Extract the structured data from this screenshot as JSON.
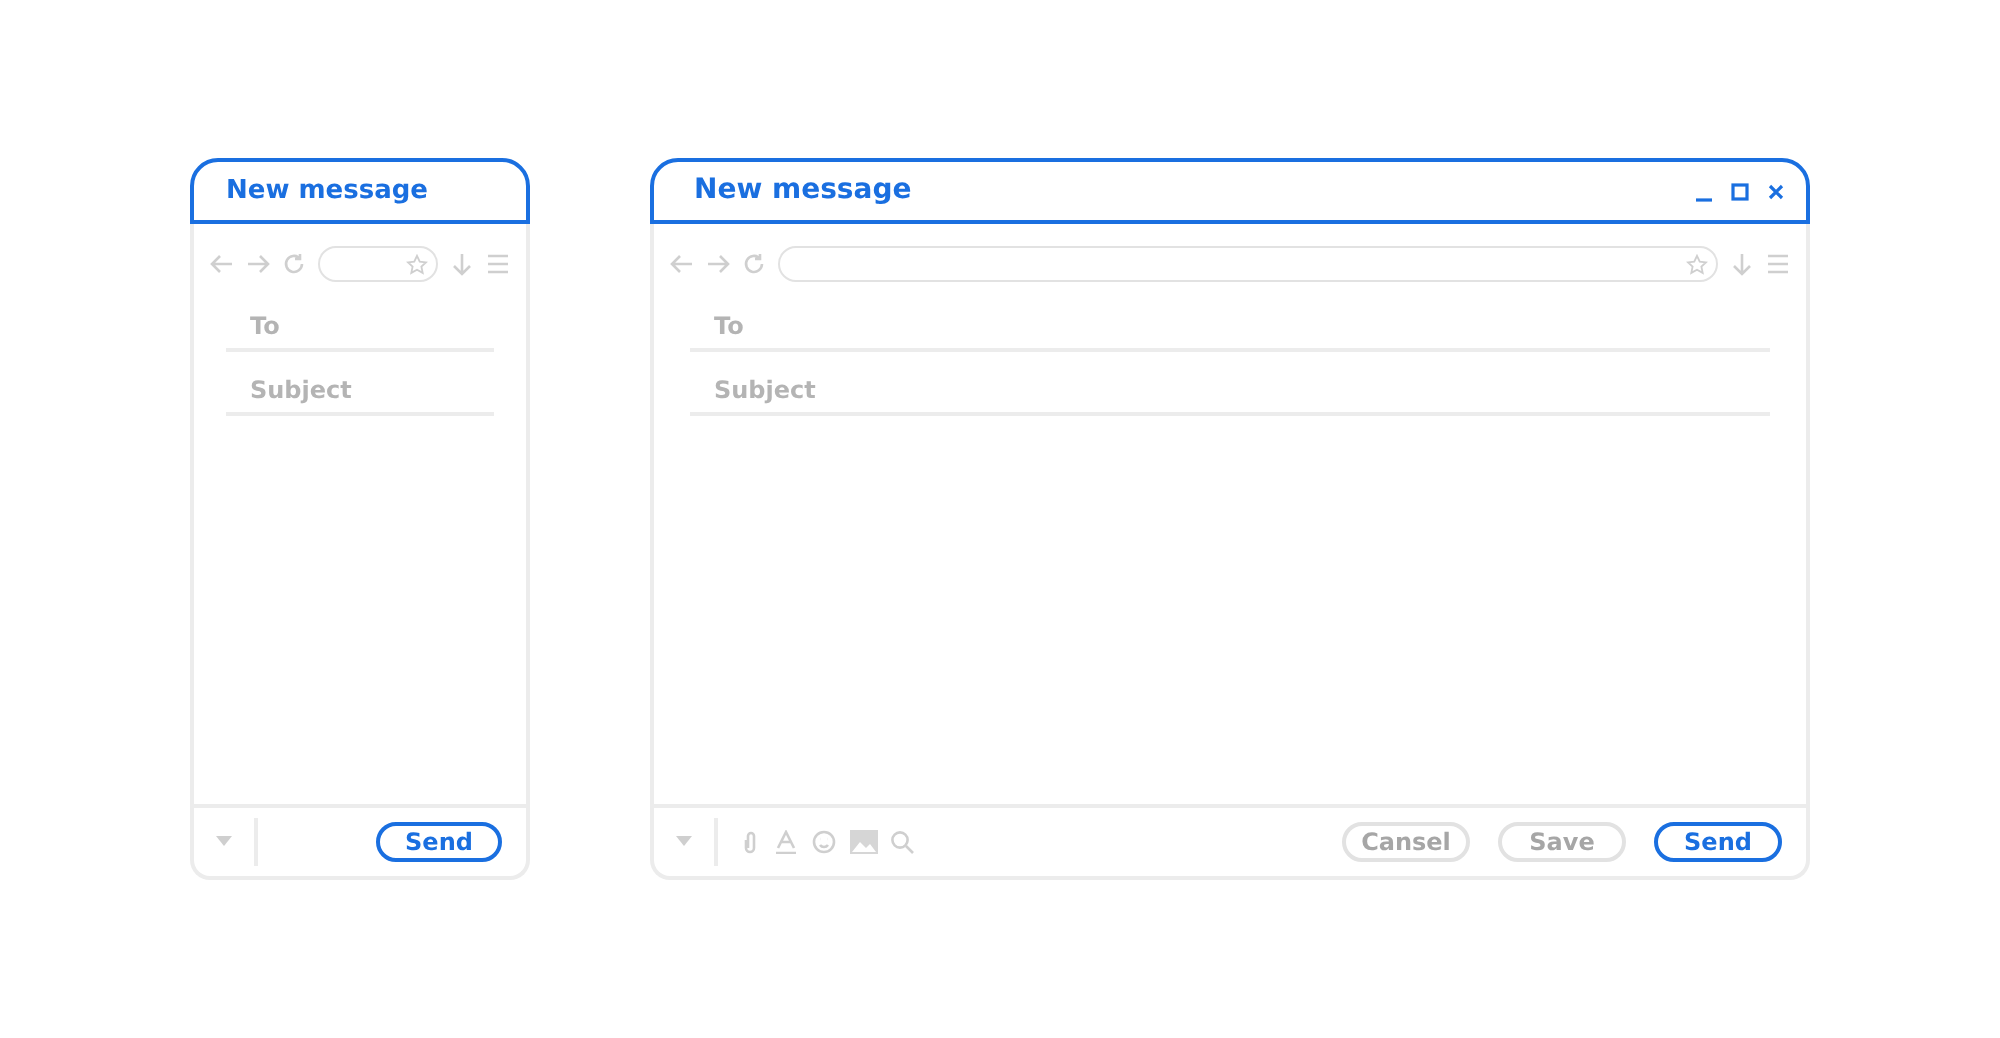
{
  "windows": [
    {
      "kind": "compact",
      "title": "New message",
      "fields": [
        {
          "placeholder": "To"
        },
        {
          "placeholder": "Subject"
        }
      ],
      "buttons": [
        {
          "label": "Send",
          "disabled": false
        }
      ]
    },
    {
      "kind": "full",
      "title": "New message",
      "fields": [
        {
          "placeholder": "To"
        },
        {
          "placeholder": "Subject"
        }
      ],
      "buttons": [
        {
          "label": "Cansel",
          "disabled": true
        },
        {
          "label": "Save",
          "disabled": true
        },
        {
          "label": "Send",
          "disabled": false
        }
      ]
    }
  ]
}
